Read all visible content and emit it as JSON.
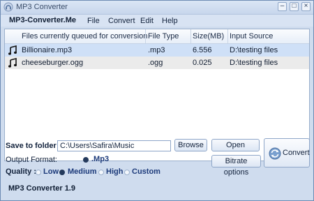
{
  "window": {
    "title": "MP3 Converter",
    "minimize_glyph": "–",
    "maximize_glyph": "□",
    "close_glyph": "×"
  },
  "menu": {
    "brand": "MP3-Converter.Me",
    "items": [
      "File",
      "Convert",
      "Edit",
      "Help"
    ]
  },
  "list": {
    "columns": [
      "Files currently queued for conversion",
      "File Type",
      "Size(MB)",
      "Input Source"
    ],
    "rows": [
      {
        "name": "Billionaire.mp3",
        "type": ".mp3",
        "size": "6.556",
        "source": "D:\\testing files",
        "selected": true
      },
      {
        "name": "cheeseburger.ogg",
        "type": ".ogg",
        "size": "0.025",
        "source": "D:\\testing files",
        "selected": false
      }
    ]
  },
  "controls": {
    "save_label": "Save to folder :",
    "folder_value": "C:\\Users\\Safira\\Music",
    "browse": "Browse",
    "open": "Open",
    "bitrate": "Bitrate options",
    "convert": "Convert",
    "output_label": "Output Format:",
    "format_option": ".Mp3",
    "quality_label": "Quality :",
    "quality_options": [
      "Low",
      "Medium",
      "High",
      "Custom"
    ],
    "quality_selected": "Medium"
  },
  "footer": "MP3 Converter 1.9",
  "colors": {
    "window_bg": "#cfdcee",
    "selected_row": "#cfe0f7",
    "alt_row": "#ebebeb",
    "radio_label": "#1c3a7a"
  }
}
